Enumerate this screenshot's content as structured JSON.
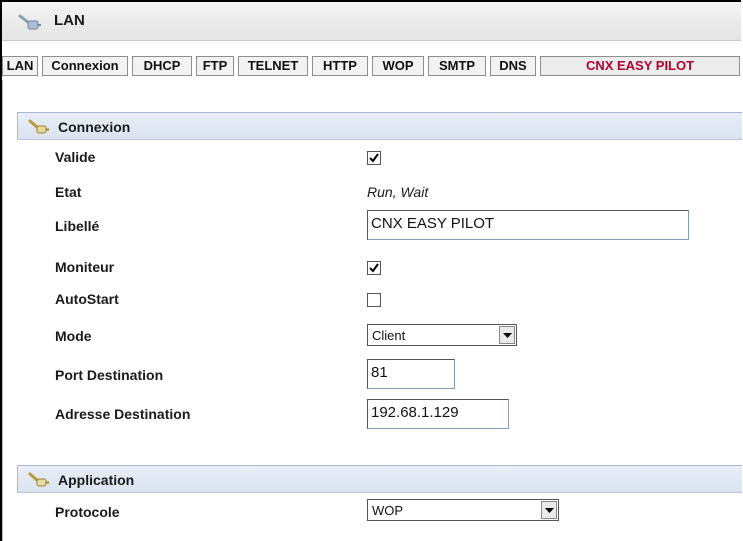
{
  "window": {
    "title": "LAN"
  },
  "tabs": [
    {
      "label": "LAN",
      "active": false
    },
    {
      "label": "Connexion",
      "active": false
    },
    {
      "label": "DHCP",
      "active": false
    },
    {
      "label": "FTP",
      "active": false
    },
    {
      "label": "TELNET",
      "active": false
    },
    {
      "label": "HTTP",
      "active": false
    },
    {
      "label": "WOP",
      "active": false
    },
    {
      "label": "SMTP",
      "active": false
    },
    {
      "label": "DNS",
      "active": false
    },
    {
      "label": "CNX EASY PILOT",
      "active": true
    }
  ],
  "connexion": {
    "title": "Connexion",
    "valide": {
      "label": "Valide",
      "checked": true
    },
    "etat": {
      "label": "Etat",
      "value": "Run, Wait"
    },
    "libelle": {
      "label": "Libellé",
      "value": "CNX EASY PILOT"
    },
    "moniteur": {
      "label": "Moniteur",
      "checked": true
    },
    "autostart": {
      "label": "AutoStart",
      "checked": false
    },
    "mode": {
      "label": "Mode",
      "value": "Client"
    },
    "port": {
      "label": "Port Destination",
      "value": "81"
    },
    "adresse": {
      "label": "Adresse Destination",
      "value": "192.68.1.129"
    }
  },
  "application": {
    "title": "Application",
    "protocole": {
      "label": "Protocole",
      "value": "WOP"
    }
  },
  "colors": {
    "active_tab_text": "#b4002d",
    "section_header": "#dfe6f3"
  },
  "icons": {
    "title": "network-cable-icon",
    "section": "network-cable-icon",
    "dropdown": "chevron-down-icon",
    "check": "checkmark-icon"
  }
}
